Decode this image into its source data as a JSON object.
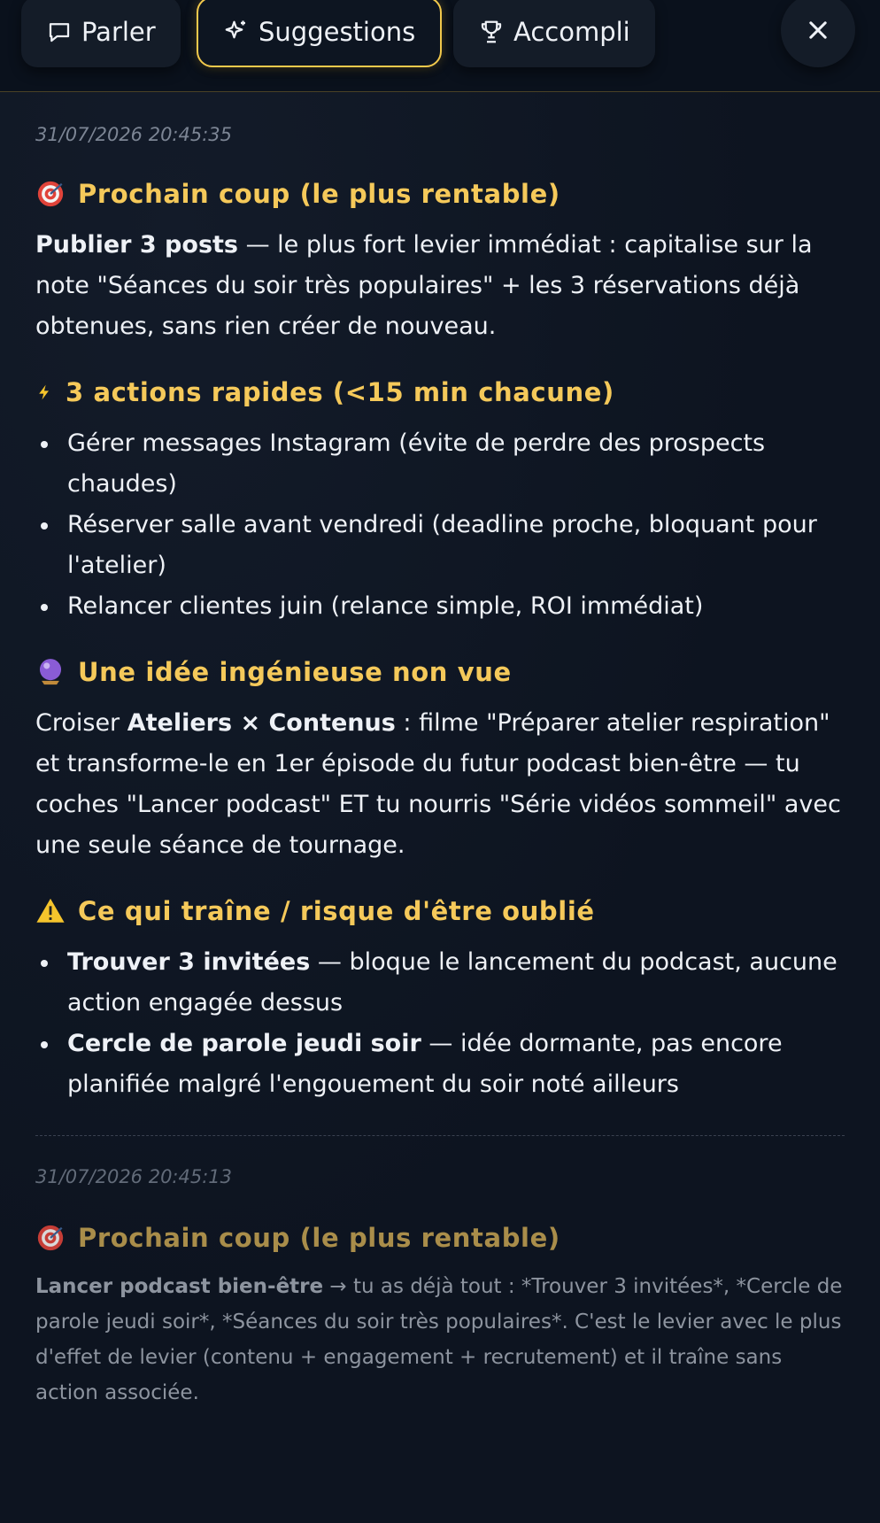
{
  "tabs": [
    {
      "label": "Parler",
      "icon": "chat-icon"
    },
    {
      "label": "Suggestions",
      "icon": "sparkle-icon",
      "active": true
    },
    {
      "label": "Accompli",
      "icon": "trophy-icon"
    }
  ],
  "close_icon": "close-icon",
  "accent": "#f2c94c",
  "entry1": {
    "timestamp": "31/07/2026 20:45:35",
    "s1": {
      "heading": "Prochain coup (le plus rentable)",
      "bold": "Publier 3 posts",
      "text": " — le plus fort levier immédiat : capitalise sur la note \"Séances du soir très populaires\" + les 3 réservations déjà obtenues, sans rien créer de nouveau."
    },
    "s2": {
      "heading": "3 actions rapides (<15 min chacune)",
      "items": [
        "Gérer messages Instagram (évite de perdre des prospects chaudes)",
        "Réserver salle avant vendredi (deadline proche, bloquant pour l'atelier)",
        "Relancer clientes juin (relance simple, ROI immédiat)"
      ]
    },
    "s3": {
      "heading": "Une idée ingénieuse non vue",
      "pre": "Croiser ",
      "bold": "Ateliers × Contenus",
      "text": " : filme \"Préparer atelier respiration\" et transforme-le en 1er épisode du futur podcast bien-être — tu coches \"Lancer podcast\" ET tu nourris \"Série vidéos sommeil\" avec une seule séance de tournage."
    },
    "s4": {
      "heading": "Ce qui traîne / risque d'être oublié",
      "items": [
        {
          "bold": "Trouver 3 invitées",
          "text": " — bloque le lancement du podcast, aucune action engagée dessus"
        },
        {
          "bold": "Cercle de parole jeudi soir",
          "text": " — idée dormante, pas encore planifiée malgré l'engouement du soir noté ailleurs"
        }
      ]
    }
  },
  "entry2": {
    "timestamp": "31/07/2026 20:45:13",
    "s1": {
      "heading": "Prochain coup (le plus rentable)",
      "bold": "Lancer podcast bien-être",
      "text": " → tu as déjà tout : *Trouver 3 invitées*, *Cercle de parole jeudi soir*, *Séances du soir très populaires*. C'est le levier avec le plus d'effet de levier (contenu + engagement + recrutement) et il traîne sans action associée."
    }
  }
}
